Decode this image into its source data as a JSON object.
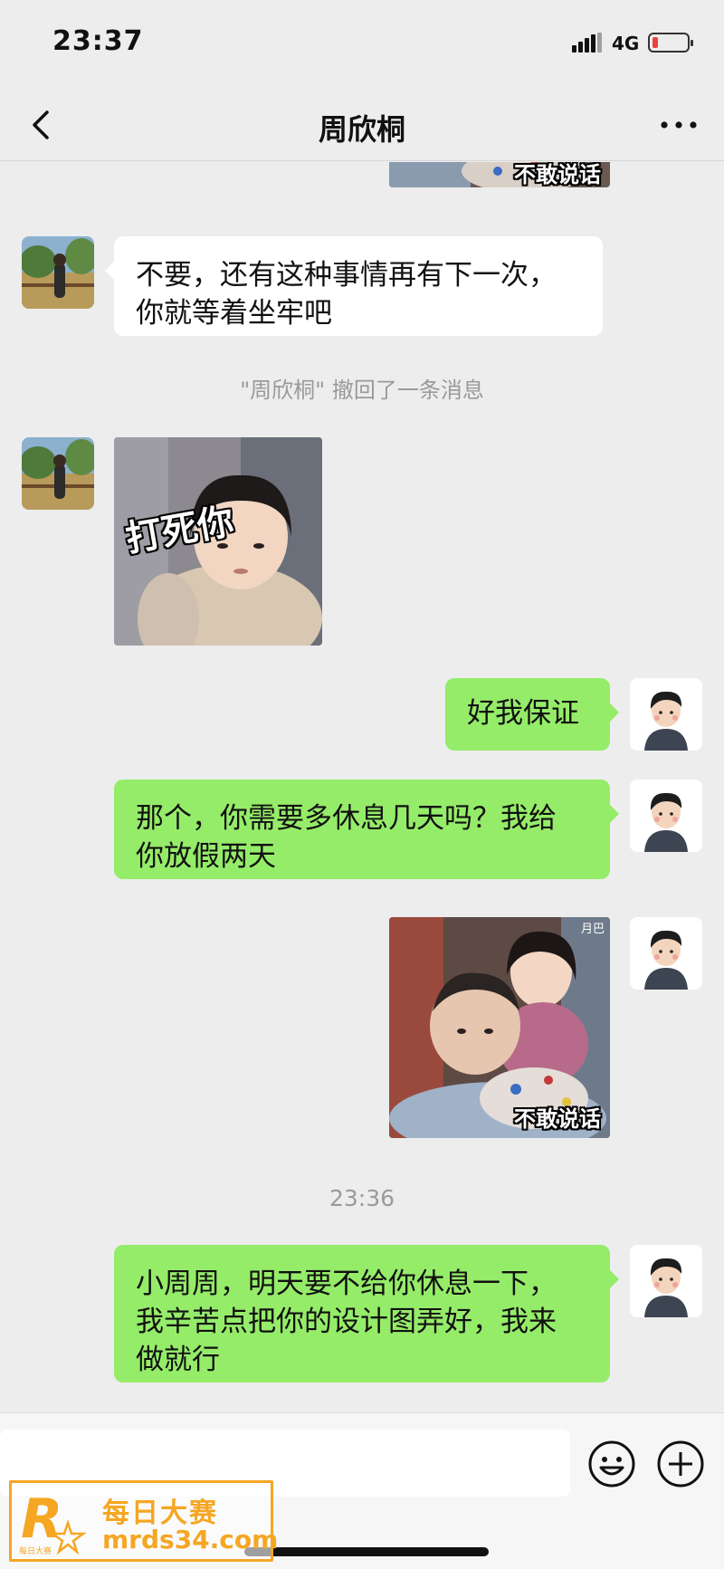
{
  "status": {
    "time": "23:37",
    "network": "4G"
  },
  "header": {
    "title": "周欣桐"
  },
  "messages": {
    "m1_line1": "不要，还有这种事情再有下一次，",
    "m1_line2": "你就等着坐牢吧",
    "recall_note": "\"周欣桐\" 撤回了一条消息",
    "sticker_left_caption": "打死你",
    "m2": "好我保证",
    "m3_line1": "那个，你需要多休息几天吗？我给",
    "m3_line2": "你放假两天",
    "sticker_right_caption": "不敢说话",
    "sticker_right_tag": "月巴",
    "time_divider": "23:36",
    "m4_line1": "小周周，明天要不给你休息一下，",
    "m4_line2": "我辛苦点把你的设计图弄好，我来",
    "m4_line3": "做就行"
  },
  "watermark": {
    "line1": "每日大赛",
    "line2": "mrds34.com",
    "logo_letter": "R",
    "logo_small": "每日大赛"
  },
  "colors": {
    "background": "#ededed",
    "bubble_sent": "#95ec69",
    "bubble_received": "#ffffff",
    "watermark": "#f5a623",
    "battery_low": "#e8443a"
  },
  "icons": [
    "back-icon",
    "more-icon",
    "emoji-icon",
    "plus-icon",
    "signal-icon",
    "battery-icon"
  ]
}
